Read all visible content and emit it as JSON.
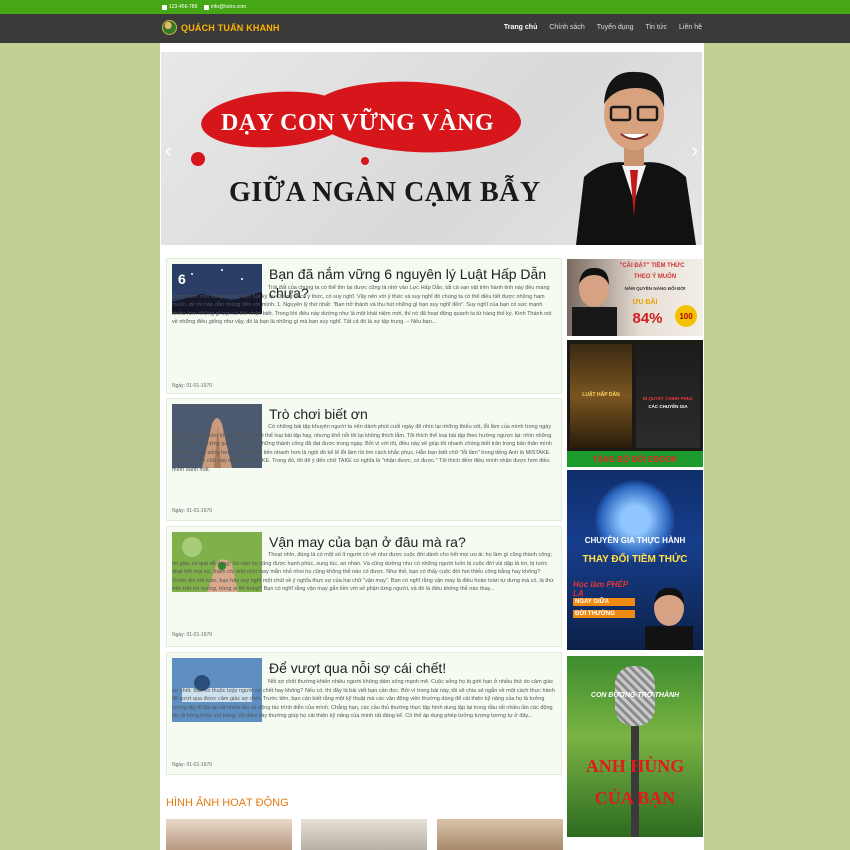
{
  "topbar": {
    "phone": "123-456-789",
    "email": "info@hstro.com"
  },
  "brand": {
    "name": "QUÁCH TUẤN KHANH"
  },
  "nav": [
    {
      "label": "Trang chủ",
      "active": true
    },
    {
      "label": "Chính sách"
    },
    {
      "label": "Tuyển dụng"
    },
    {
      "label": "Tin tức"
    },
    {
      "label": "Liên hệ"
    }
  ],
  "slider": {
    "line1": "DẠY CON VỮNG VÀNG",
    "line2": "GIỮA NGÀN CẠM BẪY",
    "prev": "‹",
    "next": "›"
  },
  "posts": [
    {
      "title": "Bạn đã nắm vững 6 nguyên lý Luật Hấp Dẫn chưa?",
      "excerpt": "Trái đất của chúng ta có thể tồn tại được cũng là nhờ vào Lực Hấp Dẫn, tất cả vạn vật trên hành tinh này đều mang trong mình một năng lượng, sức hút kỳ lạ. Chúng ta có ý thức, có suy nghĩ. Vậy nên với ý thức và suy nghĩ đó chúng ta có thể điều tiết được những ham muốn, để rồi hấp dẫn chúng đến với mình. 1. Nguyên lý thứ nhất: \"Bạn trở thành và thu hút những gì bạn suy nghĩ đến\". Suy nghĩ của bạn có sức mạnh nhiều hơn những gì bạn có thể nhận biết. Trong khi điều này dường như là một khái niệm mới, thì nó đã hoạt động quanh ta từ hàng thế kỷ. Kinh Thánh nói về những điều giống như vậy, đó là bạn là những gì mà bạn suy nghĩ. Tất cả đó là sự tập trung. – Nếu bạn...",
      "date": "Ngày: 01-01-1970"
    },
    {
      "title": "Trò chơi biết ơn",
      "excerpt": "Có những bài tập khuyên người ta nên dành phút cuối ngày để nhìn lại những thiếu sót, lỗi lầm của mình trong ngày nhằm cải thiện cho tốt hơn. Đó là một thể loại bài tập hay, nhưng khổ nỗi tôi lại không thích lắm. Tôi thích thể loại bài tập theo hướng ngược lại: nhìn những điều tốt đẹp, những giá trị tích cực, những thành công đã đạt được trong ngày. Bởi vì với tôi, điều này sẽ giúp tôi nhanh chóng biết trân trọng bản thân mình và giá trị cuộc sống hơn – nó giúp tôi tiến nhanh hơn là ngồi đó kể lể lỗi lầm rồi tìm cách khắc phục. Hẳn bạn biết chữ \"lỗi lầm\" trong tiếng Anh là MISTAKE. Tôi thích nhìn chữ này thành MIS-TAKE. Trong đó, tôi để ý đến chữ TAKE có nghĩa là \"nhận được, có được.\" Tôi thích đếm điều mình nhận được hơn điều mình đánh mất.",
      "date": "Ngày: 01-01-1970"
    },
    {
      "title": "Vận may của bạn ở đâu mà ra?",
      "excerpt": "Thoạt nhìn, đúng là có một số ít người có vẻ như được cuộc đời dành cho hết mọi ưu ái: họ làm gì cũng thành công; họ giàu có quá dễ dàng; lúc nào họ cũng được hạnh phúc, sung túc, an nhàn. Và cũng dường như có những người luôn bị cuộc đời vùi dập tả tơi, bị tước đoạt hết mọi sự, thậm chí một chút may mắn nhỏ nhoi họ cũng không thể nào có được. Như thế, bạn có thấy cuộc đời hơi thiếu công bằng hay không? Trước khi kết luận, bạn hãy suy nghĩ một chút về ý nghĩa thực sự của hai chữ \"vận may\". Bạn có nghĩ rằng vận may là điều hoàn toàn tự dưng mà có, là thứ trên trời rơi xuống, trúng ai thì trúng? Bạn có nghĩ rằng vận may gắn liền với số phận từng người, và đó là điều không thể nào thay...",
      "date": "Ngày: 01-01-1970"
    },
    {
      "title": "Để vượt qua nỗi sợ cái chết!",
      "excerpt": "Nỗi sợ chết thường khiến nhiều người không dám sống mạnh mẽ. Cuộc sống họ bị giới hạn ở nhiều thứ do cảm giác sợ chết. Bạn có thuộc tuýp người sợ chết hay không? Nếu có, thì đây là bài viết bạn cần đọc. Bởi vì trong bài này, tôi sẽ chia sẻ ngắn về một cách thực hành để vượt qua được cảm giác sợ chết. Trước tiên, bạn cần biết rằng một kỹ thuật mà các vận động viên thường dùng để cải thiện kỹ năng của họ là tưởng tượng lặp đi lặp lại rất nhiều lần về động tác trình diễn của mình. Chẳng hạn, các cầu thủ thường thực tập hình dung lặp lại trong đầu rất nhiều lần các động tác đi bóng hoặc sút bóng. Và điều này thường giúp họ cải thiện kỹ năng của mình rất đáng kể. Có thể áp dụng phép tưởng tượng tương tự ở đây...",
      "date": "Ngày: 01-01-1970"
    }
  ],
  "gallery": {
    "title": "HÌNH ẢNH HOẠT ĐỘNG"
  },
  "sidebar": {
    "ad1": {
      "line1": "\"CÀI ĐẶT\" TIỀM THỨC",
      "line2": "THEO Ý MUỐN",
      "line3": "NẮM QUYỀN NĂNG ĐỔI ĐỜI",
      "promo": "ƯU ĐÃI",
      "percent": "84%",
      "badge": "100"
    },
    "ad2": {
      "book1": "LUẬT HẤP DẪN",
      "book2": "BÍ QUYẾT CHINH PHỤC",
      "book2b": "CÁC CHUYÊN GIA",
      "banner": "TẶNG BỘ ĐÔI EBOOK"
    },
    "ad3": {
      "line1": "CHUYÊN GIA THỰC HÀNH",
      "line2": "THAY ĐỔI TIỀM THỨC",
      "line3": "Học làm PHÉP LẠ",
      "line4": "NGAY GIỮA",
      "line5": "ĐỜI THƯỜNG"
    },
    "ad4": {
      "line1": "CON ĐƯỜNG TRỞ THÀNH",
      "line2": "ANH HÙNG",
      "line3": "CỦA BẠN"
    }
  }
}
